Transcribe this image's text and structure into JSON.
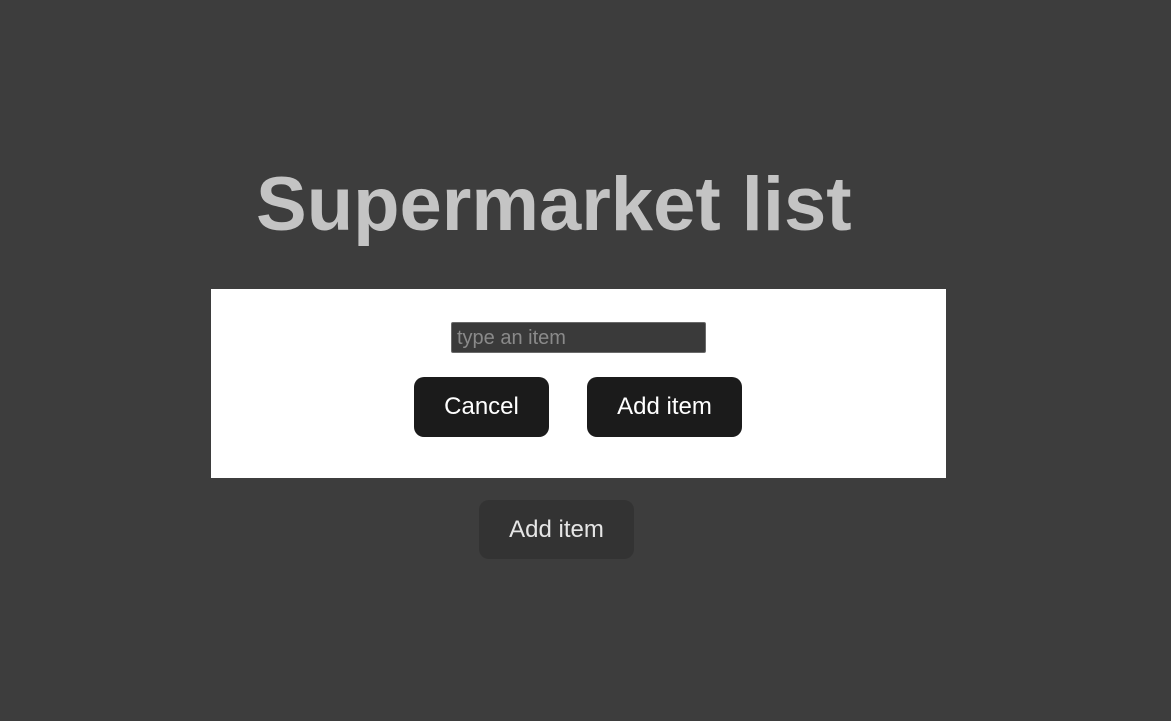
{
  "header": {
    "title": "Supermarket list"
  },
  "modal": {
    "input": {
      "value": "",
      "placeholder": "type an item"
    },
    "cancel_label": "Cancel",
    "add_label": "Add item"
  },
  "main": {
    "add_label": "Add item"
  },
  "colors": {
    "background": "#3d3d3d",
    "title": "#c4c4c4",
    "modal_background": "#ffffff",
    "dark_button": "#1b1b1b",
    "secondary_button": "#333333"
  }
}
